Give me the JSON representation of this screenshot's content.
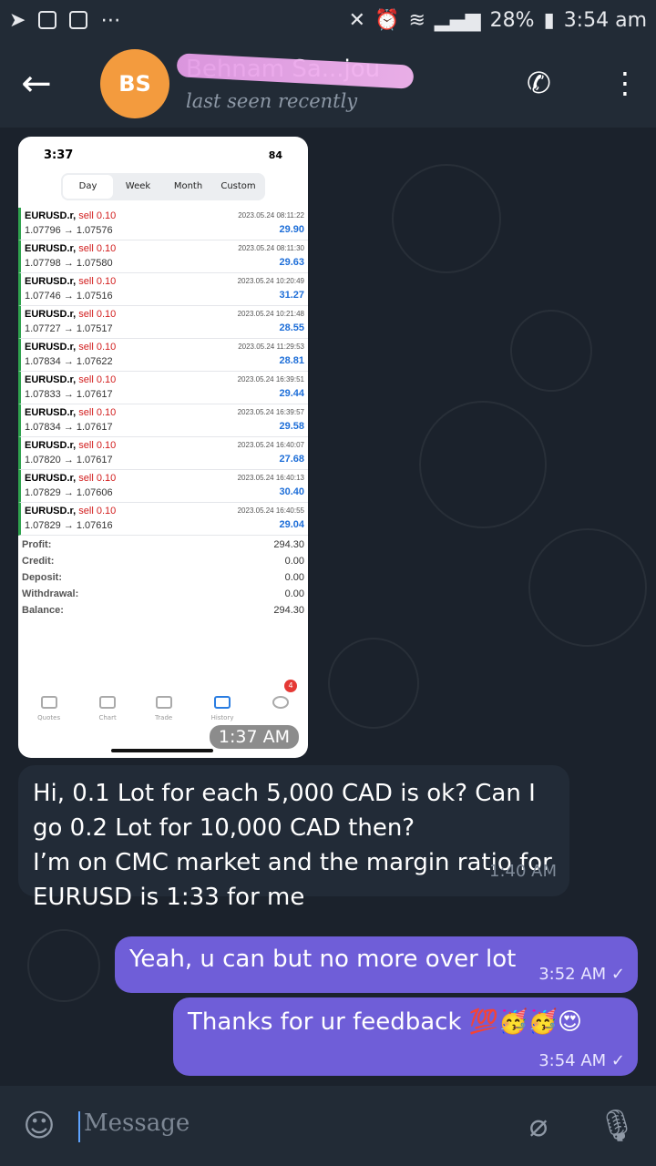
{
  "statusbar": {
    "battery": "28%",
    "time": "3:54 am"
  },
  "header": {
    "avatar_initials": "BS",
    "contact_name": "Behnam Sa...jou",
    "status": "last seen recently"
  },
  "photo": {
    "status_time": "3:37",
    "status_battery": "84",
    "tabs": [
      "Day",
      "Week",
      "Month",
      "Custom"
    ],
    "trades": [
      {
        "symbol": "EURUSD.r,",
        "action": "sell 0.10",
        "prices": "1.07796 → 1.07576",
        "date": "2023.05.24 08:11:22",
        "profit": "29.90"
      },
      {
        "symbol": "EURUSD.r,",
        "action": "sell 0.10",
        "prices": "1.07798 → 1.07580",
        "date": "2023.05.24 08:11:30",
        "profit": "29.63"
      },
      {
        "symbol": "EURUSD.r,",
        "action": "sell 0.10",
        "prices": "1.07746 → 1.07516",
        "date": "2023.05.24 10:20:49",
        "profit": "31.27"
      },
      {
        "symbol": "EURUSD.r,",
        "action": "sell 0.10",
        "prices": "1.07727 → 1.07517",
        "date": "2023.05.24 10:21:48",
        "profit": "28.55"
      },
      {
        "symbol": "EURUSD.r,",
        "action": "sell 0.10",
        "prices": "1.07834 → 1.07622",
        "date": "2023.05.24 11:29:53",
        "profit": "28.81"
      },
      {
        "symbol": "EURUSD.r,",
        "action": "sell 0.10",
        "prices": "1.07833 → 1.07617",
        "date": "2023.05.24 16:39:51",
        "profit": "29.44"
      },
      {
        "symbol": "EURUSD.r,",
        "action": "sell 0.10",
        "prices": "1.07834 → 1.07617",
        "date": "2023.05.24 16:39:57",
        "profit": "29.58"
      },
      {
        "symbol": "EURUSD.r,",
        "action": "sell 0.10",
        "prices": "1.07820 → 1.07617",
        "date": "2023.05.24 16:40:07",
        "profit": "27.68"
      },
      {
        "symbol": "EURUSD.r,",
        "action": "sell 0.10",
        "prices": "1.07829 → 1.07606",
        "date": "2023.05.24 16:40:13",
        "profit": "30.40"
      },
      {
        "symbol": "EURUSD.r,",
        "action": "sell 0.10",
        "prices": "1.07829 → 1.07616",
        "date": "2023.05.24 16:40:55",
        "profit": "29.04"
      }
    ],
    "summary": [
      {
        "k": "Profit:",
        "v": "294.30"
      },
      {
        "k": "Credit:",
        "v": "0.00"
      },
      {
        "k": "Deposit:",
        "v": "0.00"
      },
      {
        "k": "Withdrawal:",
        "v": "0.00"
      },
      {
        "k": "Balance:",
        "v": "294.30"
      }
    ],
    "bottom_tabs": [
      "Quotes",
      "Chart",
      "Trade",
      "History"
    ],
    "settings_badge": "4",
    "time": "1:37 AM"
  },
  "messages": {
    "incoming": {
      "text": "Hi, 0.1 Lot for each 5,000 CAD is ok? Can I go 0.2 Lot for 10,000 CAD then?\nI’m on CMC market and the margin ratio for EURUSD is 1:33 for me",
      "time": "1:40 AM"
    },
    "out1": {
      "text": "Yeah, u can but no more over lot",
      "time": "3:52 AM ✓"
    },
    "out2": {
      "text": "Thanks for ur feedback 💯🥳🥳😍",
      "time": "3:54 AM ✓"
    }
  },
  "input": {
    "placeholder": "Message"
  }
}
